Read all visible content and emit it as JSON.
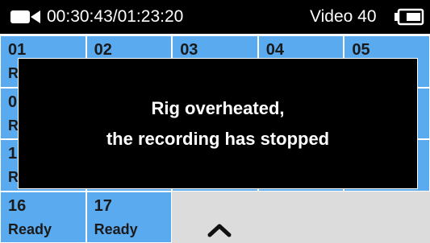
{
  "status": {
    "camera_icon": "video-camera-icon",
    "timecode": "00:30:43/01:23:20",
    "video_label": "Video 40",
    "battery_icon": "battery-icon"
  },
  "tiles": [
    {
      "num": "01",
      "status": "R"
    },
    {
      "num": "02",
      "status": ""
    },
    {
      "num": "03",
      "status": ""
    },
    {
      "num": "04",
      "status": ""
    },
    {
      "num": "05",
      "status": ""
    },
    {
      "num": "0",
      "status": "R"
    },
    {
      "num": "",
      "status": ""
    },
    {
      "num": "",
      "status": ""
    },
    {
      "num": "",
      "status": ""
    },
    {
      "num": "",
      "status": ""
    },
    {
      "num": "1",
      "status": "R"
    },
    {
      "num": "",
      "status": ""
    },
    {
      "num": "",
      "status": ""
    },
    {
      "num": "",
      "status": ""
    },
    {
      "num": "",
      "status": ""
    },
    {
      "num": "16",
      "status": "Ready"
    },
    {
      "num": "17",
      "status": "Ready"
    }
  ],
  "scroll_icon": "chevron-up-icon",
  "alert": {
    "line1": "Rig overheated,",
    "line2": "the recording has stopped"
  },
  "colors": {
    "tile": "#5aaaf0",
    "status_bar": "#000000",
    "empty_area": "#dcdcdc"
  }
}
